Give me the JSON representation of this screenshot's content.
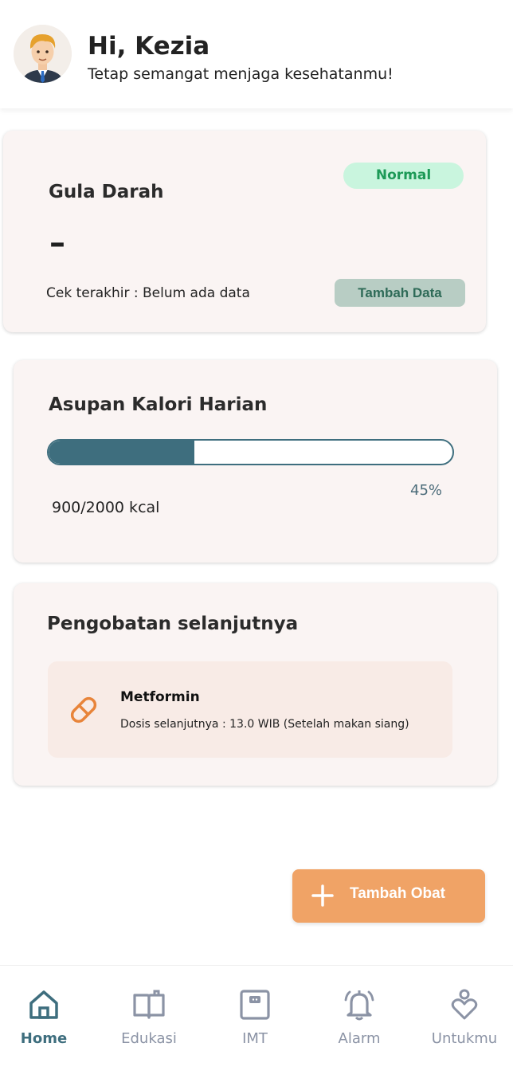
{
  "header": {
    "greeting": "Hi, Kezia",
    "subtitle": "Tetap semangat menjaga kesehatanmu!",
    "avatar_icon": "user-avatar-icon"
  },
  "gula_darah": {
    "title": "Gula Darah",
    "status": "Normal",
    "value": "–",
    "last_check": "Cek terakhir : Belum ada data",
    "add_button": "Tambah Data"
  },
  "kalori": {
    "title": "Asupan Kalori Harian",
    "progress": 0.45,
    "percent_label": "45%",
    "amount_label": "900/2000 kcal"
  },
  "pengobatan": {
    "title": "Pengobatan selanjutnya",
    "medicine": {
      "icon": "pill-icon",
      "name": "Metformin",
      "dose": "Dosis selanjutnya : 13.0 WIB (Setelah makan siang)"
    }
  },
  "fab": {
    "label": "Tambah Obat",
    "icon": "plus-icon"
  },
  "nav": {
    "items": [
      {
        "label": "Home",
        "icon": "home-icon",
        "active": true
      },
      {
        "label": "Edukasi",
        "icon": "book-icon",
        "active": false
      },
      {
        "label": "IMT",
        "icon": "scale-icon",
        "active": false
      },
      {
        "label": "Alarm",
        "icon": "bell-icon",
        "active": false
      },
      {
        "label": "Untukmu",
        "icon": "heart-person-icon",
        "active": false
      }
    ]
  },
  "colors": {
    "accent": "#3e6e7e",
    "orange": "#f0a366",
    "normal_badge_bg": "#c9f5de",
    "normal_badge_text": "#1d9a57",
    "card_bg": "#faf4f3"
  }
}
